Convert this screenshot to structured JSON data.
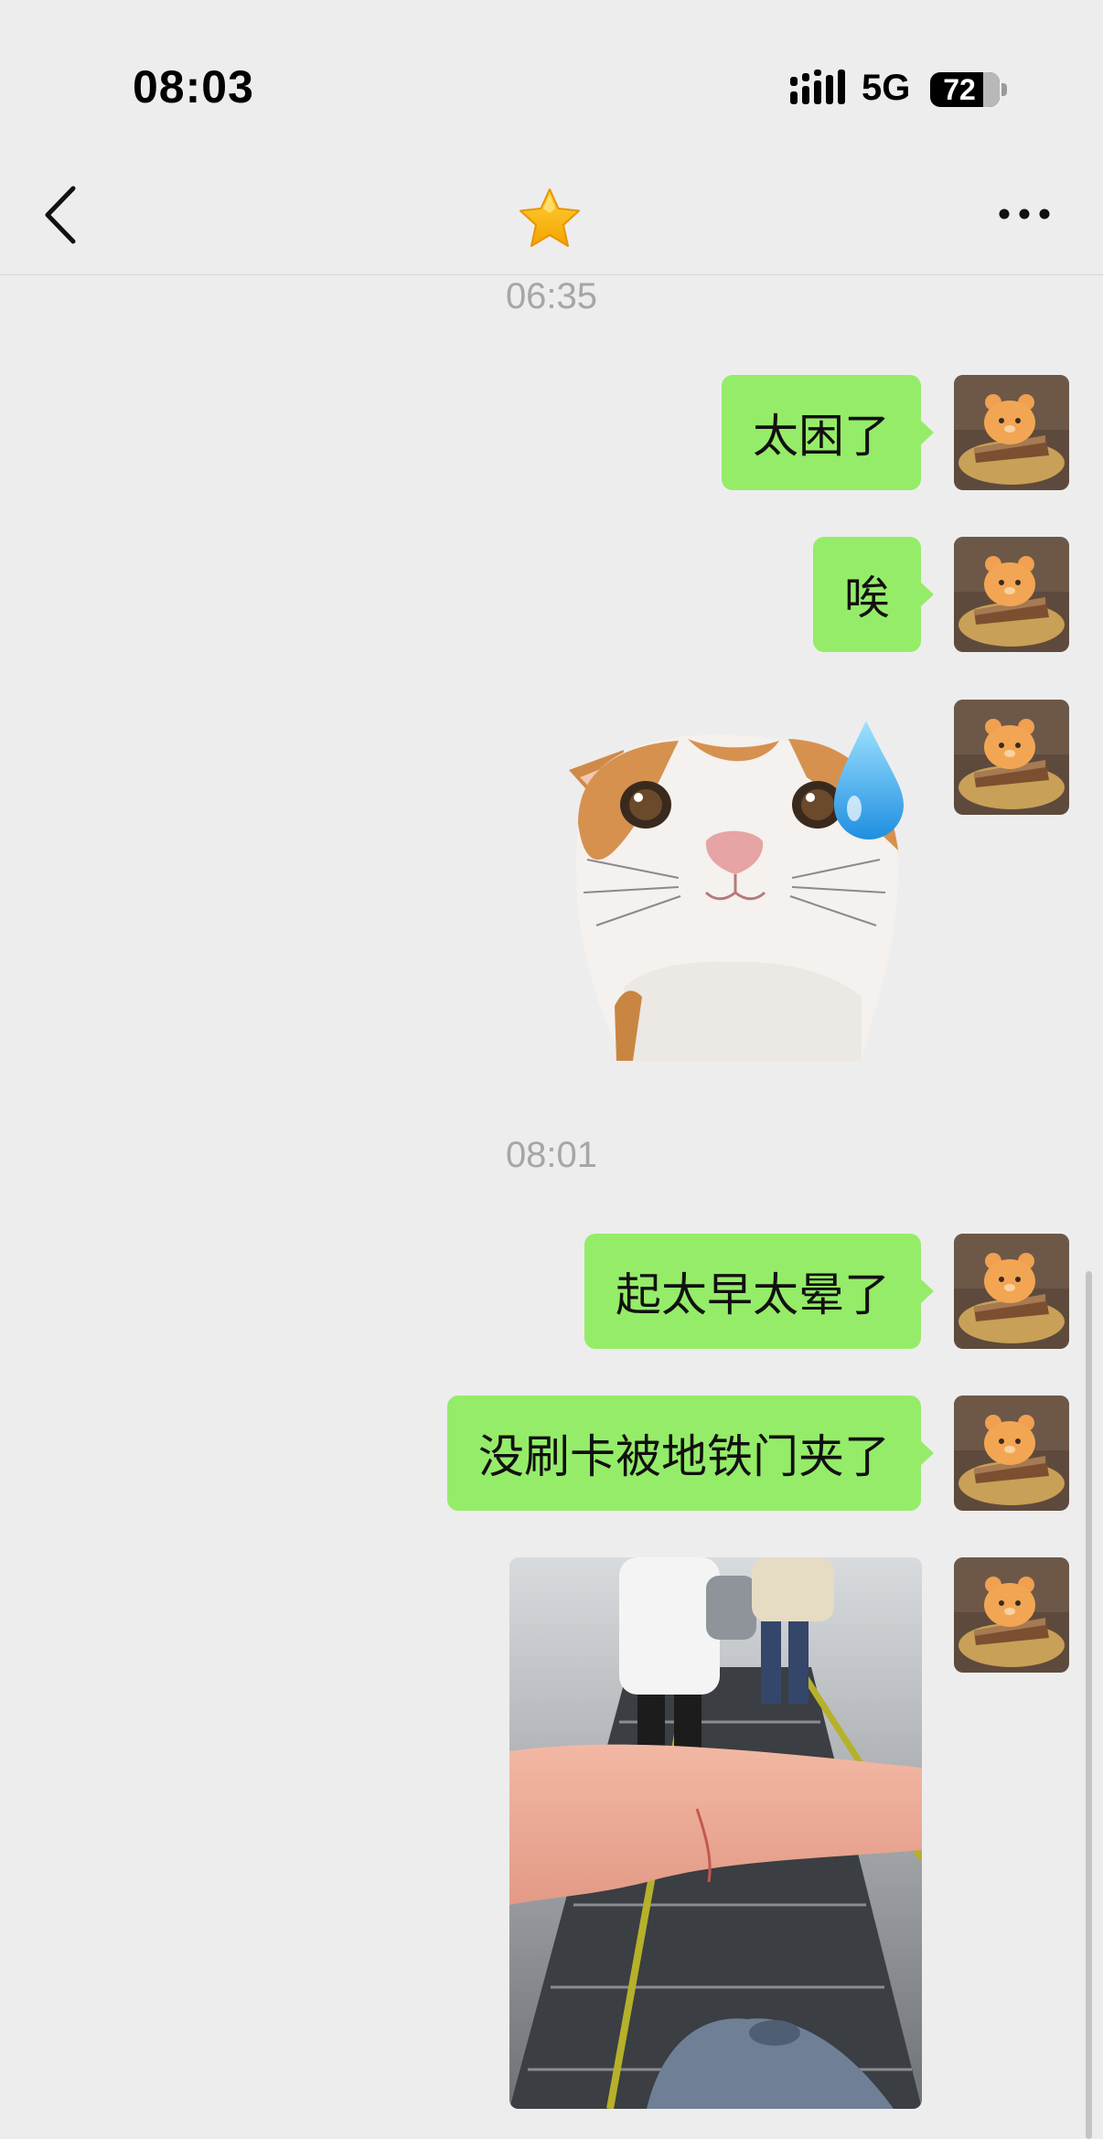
{
  "status_bar": {
    "time": "08:03",
    "network": "5G",
    "battery": "72",
    "signal_icon": "signal-bars-icon"
  },
  "nav": {
    "back_icon": "chevron-left-icon",
    "title_icon": "star-icon",
    "more_icon": "ellipsis-icon"
  },
  "chat": {
    "groups": [
      {
        "time": "06:35",
        "messages": [
          {
            "type": "text",
            "text": "太困了"
          },
          {
            "type": "text",
            "text": "唉"
          },
          {
            "type": "sticker",
            "icon": "cat-sweat-sticker"
          }
        ]
      },
      {
        "time": "08:01",
        "messages": [
          {
            "type": "text",
            "text": "起太早太晕了"
          },
          {
            "type": "text",
            "text": "没刷卡被地铁门夹了"
          },
          {
            "type": "image",
            "icon": "escalator-arm-photo"
          }
        ]
      }
    ]
  },
  "colors": {
    "bubble": "#95ec69",
    "background": "#ededed",
    "timestamp": "#a6a6a6"
  }
}
